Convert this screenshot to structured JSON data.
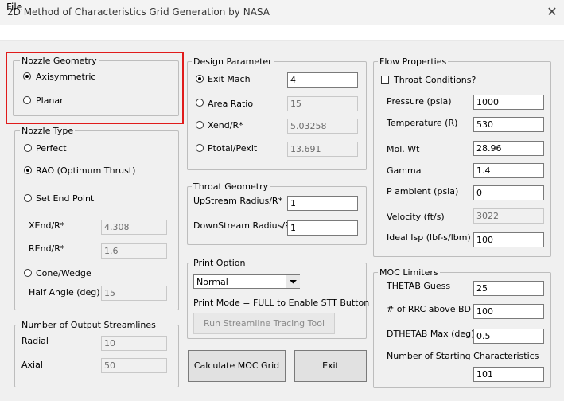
{
  "window": {
    "title": "2D Method of Characteristics Grid Generation by NASA",
    "close": "✕"
  },
  "menu": {
    "file": "File"
  },
  "nozzle_geometry": {
    "legend": "Nozzle Geometry",
    "axisymmetric": "Axisymmetric",
    "planar": "Planar"
  },
  "nozzle_type": {
    "legend": "Nozzle Type",
    "perfect": "Perfect",
    "rao": "RAO (Optimum Thrust)",
    "set_end_point": "Set End Point",
    "xend_label": "XEnd/R*",
    "xend_value": "4.308",
    "rend_label": "REnd/R*",
    "rend_value": "1.6",
    "cone_wedge": "Cone/Wedge",
    "half_angle_label": "Half Angle (deg)",
    "half_angle_value": "15"
  },
  "streamlines": {
    "legend": "Number of Output Streamlines",
    "radial_label": "Radial",
    "radial_value": "10",
    "axial_label": "Axial",
    "axial_value": "50"
  },
  "design": {
    "legend": "Design Parameter",
    "exit_mach": "Exit Mach",
    "exit_mach_value": "4",
    "area_ratio": "Area Ratio",
    "area_ratio_value": "15",
    "xend": "Xend/R*",
    "xend_value": "5.03258",
    "ptotal": "Ptotal/Pexit",
    "ptotal_value": "13.691"
  },
  "throat_geom": {
    "legend": "Throat Geometry",
    "upstream_label": "UpStream Radius/R*",
    "upstream_value": "1",
    "downstream_label": "DownStream Radius/R*",
    "downstream_value": "1"
  },
  "print": {
    "legend": "Print Option",
    "selected": "Normal",
    "note": "Print Mode = FULL to Enable STT Button",
    "stt_button": "Run Streamline Tracing Tool"
  },
  "buttons": {
    "calculate": "Calculate MOC Grid",
    "exit": "Exit"
  },
  "flow": {
    "legend": "Flow Properties",
    "throat_conditions": "Throat Conditions?",
    "pressure_label": "Pressure (psia)",
    "pressure_value": "1000",
    "temperature_label": "Temperature (R)",
    "temperature_value": "530",
    "molwt_label": "Mol. Wt",
    "molwt_value": "28.96",
    "gamma_label": "Gamma",
    "gamma_value": "1.4",
    "pamb_label": "P ambient (psia)",
    "pamb_value": "0",
    "velocity_label": "Velocity (ft/s)",
    "velocity_value": "3022",
    "isp_label": "Ideal Isp (lbf-s/lbm)",
    "isp_value": "100"
  },
  "moc": {
    "legend": "MOC Limiters",
    "thetab_label": "THETAB Guess",
    "thetab_value": "25",
    "rrc_label": "# of RRC above BD",
    "rrc_value": "100",
    "dthetab_label": "DTHETAB Max (deg)",
    "dthetab_value": "0.5",
    "nstart_label": "Number of Starting Characteristics",
    "nstart_value": "101"
  },
  "colors": {
    "highlight": "#e01b1b",
    "window_bg": "#f0f0f0"
  }
}
